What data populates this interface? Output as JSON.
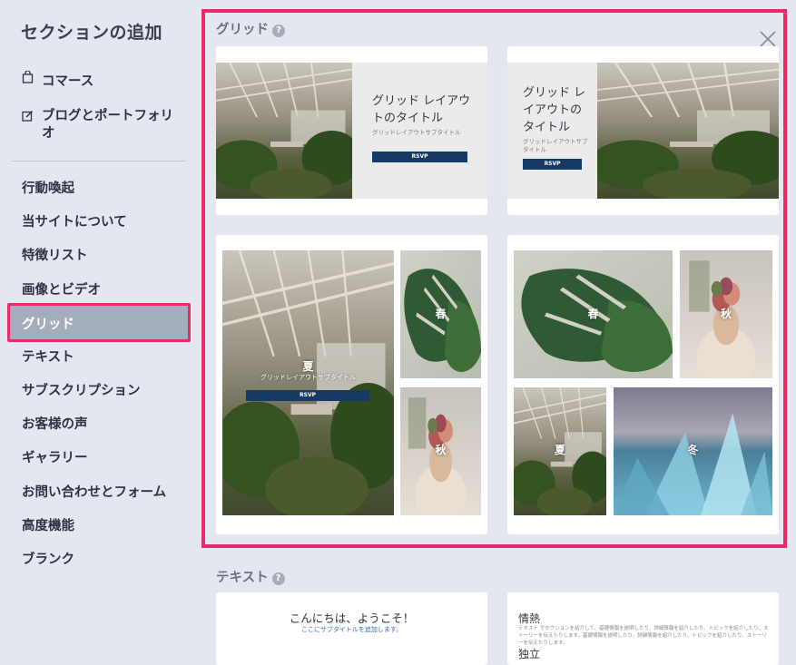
{
  "sidebar": {
    "title": "セクションの追加",
    "items_top": [
      {
        "label": "コマース",
        "icon": "shopping-bag-icon"
      },
      {
        "label": "ブログとポートフォリオ",
        "icon": "edit-icon"
      }
    ],
    "items": [
      "行動喚起",
      "当サイトについて",
      "特徴リスト",
      "画像とビデオ",
      "グリッド",
      "テキスト",
      "サブスクリプション",
      "お客様の声",
      "ギャラリー",
      "お問い合わせとフォーム",
      "高度機能",
      "ブランク"
    ],
    "active_item": "グリッド"
  },
  "grid_section": {
    "title": "グリッド",
    "card1": {
      "title": "グリッド レイアウトのタイトル",
      "subtitle": "グリッドレイアウトサブタイトル",
      "button": "RSVP"
    },
    "card2": {
      "title": "グリッド レイアウトのタイトル",
      "subtitle": "グリッドレイアウトサブタイトル",
      "button": "RSVP"
    },
    "card3": {
      "main_label": "夏",
      "main_subtitle": "グリッドレイアウトサブタイトル",
      "button": "RSVP",
      "tile2": "春",
      "tile3": "秋"
    },
    "card4": {
      "tile1": "春",
      "tile2": "秋",
      "tile3": "夏",
      "tile4": "冬"
    }
  },
  "text_section": {
    "title": "テキスト",
    "card1": {
      "heading": "こんにちは、ようこそ！",
      "subtitle": "ここにサブタイトルを追加します。"
    },
    "card2": {
      "heading1": "情熱",
      "paragraph": "テキスト でセクションを紹介して、基礎情報を説明したり、詳細情報を紹介したり、トピックを紹介したり、ストーリーを伝えたりします。基礎情報を説明したり、詳細情報を紹介したり、トピックを紹介したり、ストーリーを伝えたりします。",
      "heading2": "独立"
    }
  },
  "colors": {
    "highlight": "#ec2a68",
    "rsvp_button": "#163a63",
    "active_bg": "#a4adbd"
  }
}
